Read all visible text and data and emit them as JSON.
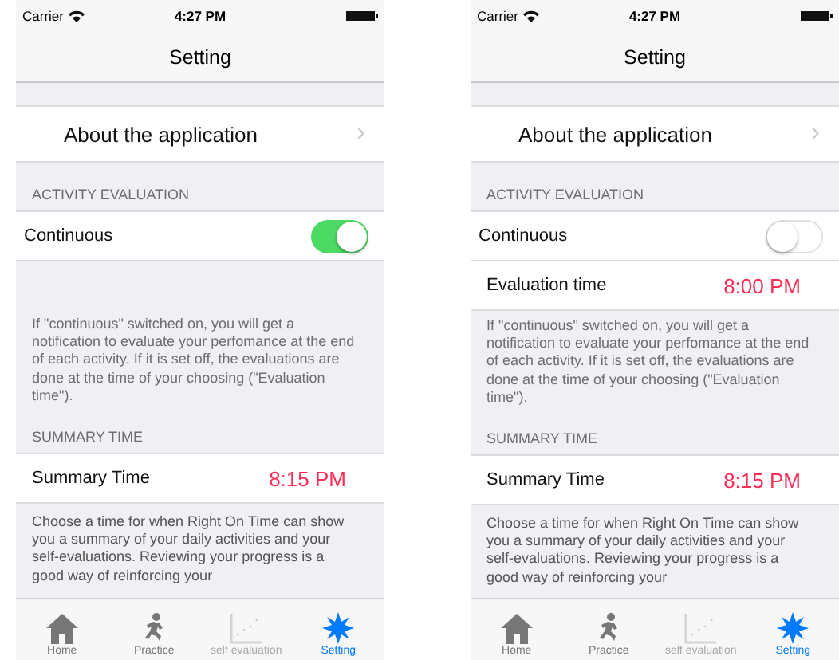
{
  "screens": [
    {
      "status_bar": {
        "carrier": "Carrier",
        "time": "4:27 PM"
      },
      "title": "Setting",
      "about": {
        "label": "About the application",
        "chevron": "›"
      },
      "activity_header": "ACTIVITY EVALUATION",
      "continuous": {
        "label": "Continuous",
        "on": true
      },
      "activity_footer": "If \"continuous\" switched on, you will get a notification to evaluate your perfomance at the end of each activity. If it is set off, the evaluations are done at the time of your choosing (\"Evaluation time\").",
      "summary_header": "SUMMARY TIME",
      "summary": {
        "label": "Summary Time",
        "value": "8:15 PM"
      },
      "summary_footer": "Choose a time for when Right On Time can show you a summary of your daily activities and your self-evaluations. Reviewing your progress is a good way of reinforcing your",
      "tabs": [
        {
          "kind": "home",
          "label": "Home",
          "selected": false,
          "disabled": false
        },
        {
          "kind": "practice",
          "label": "Practice",
          "selected": false,
          "disabled": false
        },
        {
          "kind": "chart",
          "label": "self evaluation",
          "selected": false,
          "disabled": true
        },
        {
          "kind": "setting",
          "label": "Setting",
          "selected": true,
          "disabled": false
        }
      ]
    },
    {
      "status_bar": {
        "carrier": "Carrier",
        "time": "4:27 PM"
      },
      "title": "Setting",
      "about": {
        "label": "About the application",
        "chevron": "›"
      },
      "activity_header": "ACTIVITY EVALUATION",
      "continuous": {
        "label": "Continuous",
        "on": false
      },
      "evaluation": {
        "label": "Evaluation time",
        "value": "8:00 PM"
      },
      "activity_footer": "If \"continuous\" switched on, you will get a notification to evaluate your perfomance at the end of each activity. If it is set off, the evaluations are done at the time of your choosing (\"Evaluation time\").",
      "summary_header": "SUMMARY TIME",
      "summary": {
        "label": "Summary Time",
        "value": "8:15 PM"
      },
      "summary_footer": "Choose a time for when Right On Time can show you a summary of your daily activities and your self-evaluations. Reviewing your progress is a good way of reinforcing your",
      "tabs": [
        {
          "kind": "home",
          "label": "Home",
          "selected": false,
          "disabled": false
        },
        {
          "kind": "practice",
          "label": "Practice",
          "selected": false,
          "disabled": false
        },
        {
          "kind": "chart",
          "label": "self evaluation",
          "selected": false,
          "disabled": true
        },
        {
          "kind": "setting",
          "label": "Setting",
          "selected": true,
          "disabled": false
        }
      ]
    }
  ]
}
